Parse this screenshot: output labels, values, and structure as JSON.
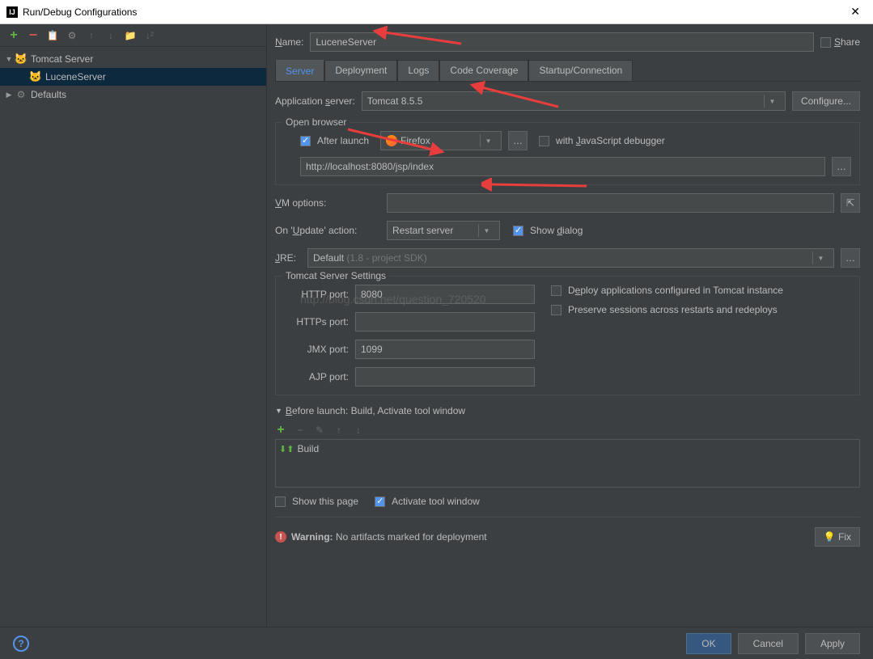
{
  "window": {
    "title": "Run/Debug Configurations"
  },
  "tree": {
    "tomcat_server": "Tomcat Server",
    "lucene_server": "LuceneServer",
    "defaults": "Defaults"
  },
  "form": {
    "name_label": "Name:",
    "name_value": "LuceneServer",
    "share": "Share"
  },
  "tabs": [
    "Server",
    "Deployment",
    "Logs",
    "Code Coverage",
    "Startup/Connection"
  ],
  "server": {
    "app_server_label": "Application server:",
    "app_server_value": "Tomcat 8.5.5",
    "configure": "Configure...",
    "open_browser": "Open browser",
    "after_launch": "After launch",
    "browser": "Firefox",
    "with_js_debugger": "with JavaScript debugger",
    "url": "http://localhost:8080/jsp/index",
    "vm_options": "VM options:",
    "on_update_label": "On 'Update' action:",
    "on_update_value": "Restart server",
    "show_dialog": "Show dialog",
    "jre_label": "JRE:",
    "jre_value": "Default ",
    "jre_hint": "(1.8 - project SDK)",
    "tomcat_settings": "Tomcat Server Settings",
    "http_port_label": "HTTP port:",
    "http_port": "8080",
    "https_port_label": "HTTPs port:",
    "https_port": "",
    "jmx_port_label": "JMX port:",
    "jmx_port": "1099",
    "ajp_port_label": "AJP port:",
    "ajp_port": "",
    "deploy_tomcat": "Deploy applications configured in Tomcat instance",
    "preserve_sessions": "Preserve sessions across restarts and redeploys"
  },
  "before_launch": {
    "title": "Before launch: Build, Activate tool window",
    "build": "Build",
    "show_this_page": "Show this page",
    "activate_tool": "Activate tool window"
  },
  "warning": {
    "label": "Warning:",
    "text": "No artifacts marked for deployment",
    "fix": "Fix"
  },
  "footer": {
    "ok": "OK",
    "cancel": "Cancel",
    "apply": "Apply"
  },
  "watermark": "http://blog.csdn.net/question_720520"
}
